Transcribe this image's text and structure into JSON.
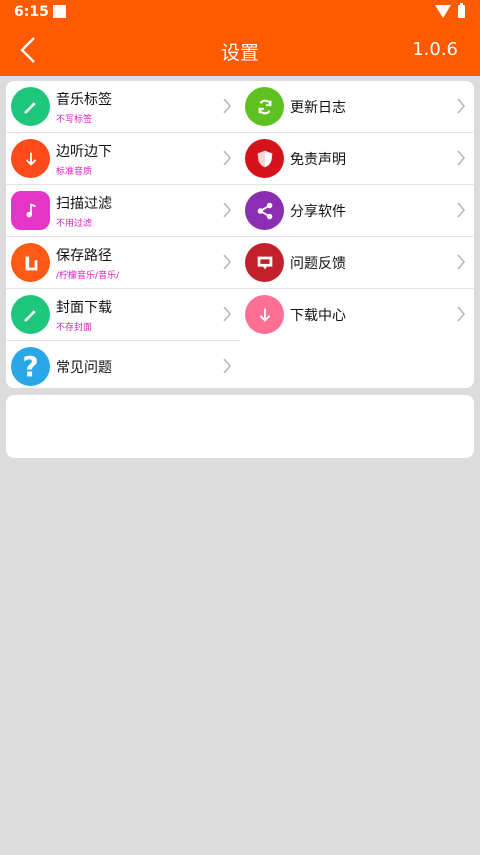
{
  "status": {
    "time": "6:15"
  },
  "appbar": {
    "title": "设置",
    "version": "1.0.6"
  },
  "left_items": [
    {
      "label": "音乐标签",
      "sub": "不写标签",
      "color": "#1fc77c",
      "icon": "pencil-icon"
    },
    {
      "label": "边听边下",
      "sub": "标准音质",
      "color": "#ff4a1a",
      "icon": "download-arrow-icon"
    },
    {
      "label": "扫描过滤",
      "sub": "不用过滤",
      "color": "#e535c8",
      "icon": "music-note-icon"
    },
    {
      "label": "保存路径",
      "sub": "/柠檬音乐/音乐/",
      "color": "#ff5a15",
      "icon": "folder-path-icon"
    },
    {
      "label": "封面下载",
      "sub": "不存封面",
      "color": "#1fc77c",
      "icon": "pencil-icon"
    },
    {
      "label": "常见问题",
      "sub": "",
      "color": "#2aa7e6",
      "icon": "question-icon"
    }
  ],
  "right_items": [
    {
      "label": "更新日志",
      "color": "#5ec021",
      "icon": "refresh-icon"
    },
    {
      "label": "免责声明",
      "color": "#d6131a",
      "icon": "shield-icon"
    },
    {
      "label": "分享软件",
      "color": "#8b2fb2",
      "icon": "share-icon"
    },
    {
      "label": "问题反馈",
      "color": "#c2212c",
      "icon": "chat-icon"
    },
    {
      "label": "下载中心",
      "color": "#ff6f95",
      "icon": "download-arrow-icon"
    }
  ]
}
